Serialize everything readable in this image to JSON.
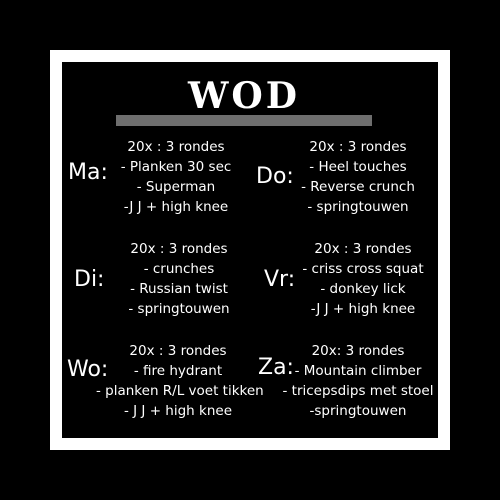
{
  "title": "WOD",
  "colors": {
    "background": "#000000",
    "frame": "#ffffff",
    "bar": "#6e6e6e",
    "text": "#ffffff"
  },
  "days": [
    {
      "label": "Ma:",
      "lines": [
        "20x : 3 rondes",
        "- Planken 30 sec",
        "- Superman",
        "-J J + high knee"
      ]
    },
    {
      "label": "Do:",
      "lines": [
        "20x : 3 rondes",
        "- Heel touches",
        "- Reverse  crunch",
        "- springtouwen"
      ]
    },
    {
      "label": "Di:",
      "lines": [
        "20x : 3 rondes",
        "- crunches",
        "- Russian twist",
        "- springtouwen"
      ]
    },
    {
      "label": "Vr:",
      "lines": [
        "20x : 3 rondes",
        "- criss cross squat",
        "- donkey lick",
        "-J  J + high knee"
      ]
    },
    {
      "label": "Wo:",
      "lines": [
        "20x : 3 rondes",
        "- fire hydrant",
        "- planken R/L voet tikken",
        "- J J + high knee"
      ]
    },
    {
      "label": "Za:",
      "lines": [
        "20x: 3 rondes",
        "- Mountain climber",
        "- tricepsdips met stoel",
        "-springtouwen"
      ]
    }
  ]
}
